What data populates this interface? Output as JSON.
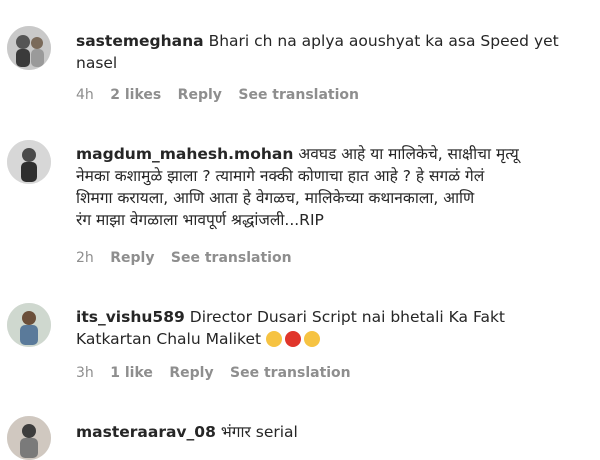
{
  "comments": [
    {
      "username": "sastemeghana",
      "lines": [
        "Bhari ch na aplya aoushyat ka asa Speed yet",
        "nasel"
      ],
      "time": "4h",
      "likes": "2 likes",
      "reply": "Reply",
      "translate": "See translation",
      "avatar_icon": "user-avatar"
    },
    {
      "username": "magdum_mahesh.mohan",
      "lines": [
        "अवघड आहे या मालिकेचे, साक्षीचा मृत्यू",
        "नेमका कशामुळे झाला ? त्यामागे नक्की कोणाचा हात आहे ? हे सगळं गेलं",
        "शिमगा करायला, आणि आता हे वेगळच, मालिकेच्या कथानकाला, आणि",
        "रंग माझा वेगळाला भावपूर्ण श्रद्धांजली...RIP"
      ],
      "time": "2h",
      "reply": "Reply",
      "translate": "See translation",
      "avatar_icon": "user-avatar"
    },
    {
      "username": "its_vishu589",
      "lines": [
        "Director Dusari Script nai bhetali Ka Fakt",
        "Katkartan Chalu Maliket"
      ],
      "emojis": [
        "sad-face-emoji",
        "angry-face-emoji",
        "sweat-smile-emoji"
      ],
      "time": "3h",
      "likes": "1 like",
      "reply": "Reply",
      "translate": "See translation",
      "avatar_icon": "user-avatar"
    },
    {
      "username": "masteraarav_08",
      "lines": [
        "भंगार serial"
      ],
      "avatar_icon": "user-avatar"
    }
  ],
  "colors": {
    "text": "#262626",
    "meta": "#8e8e8e",
    "background": "#ffffff"
  }
}
